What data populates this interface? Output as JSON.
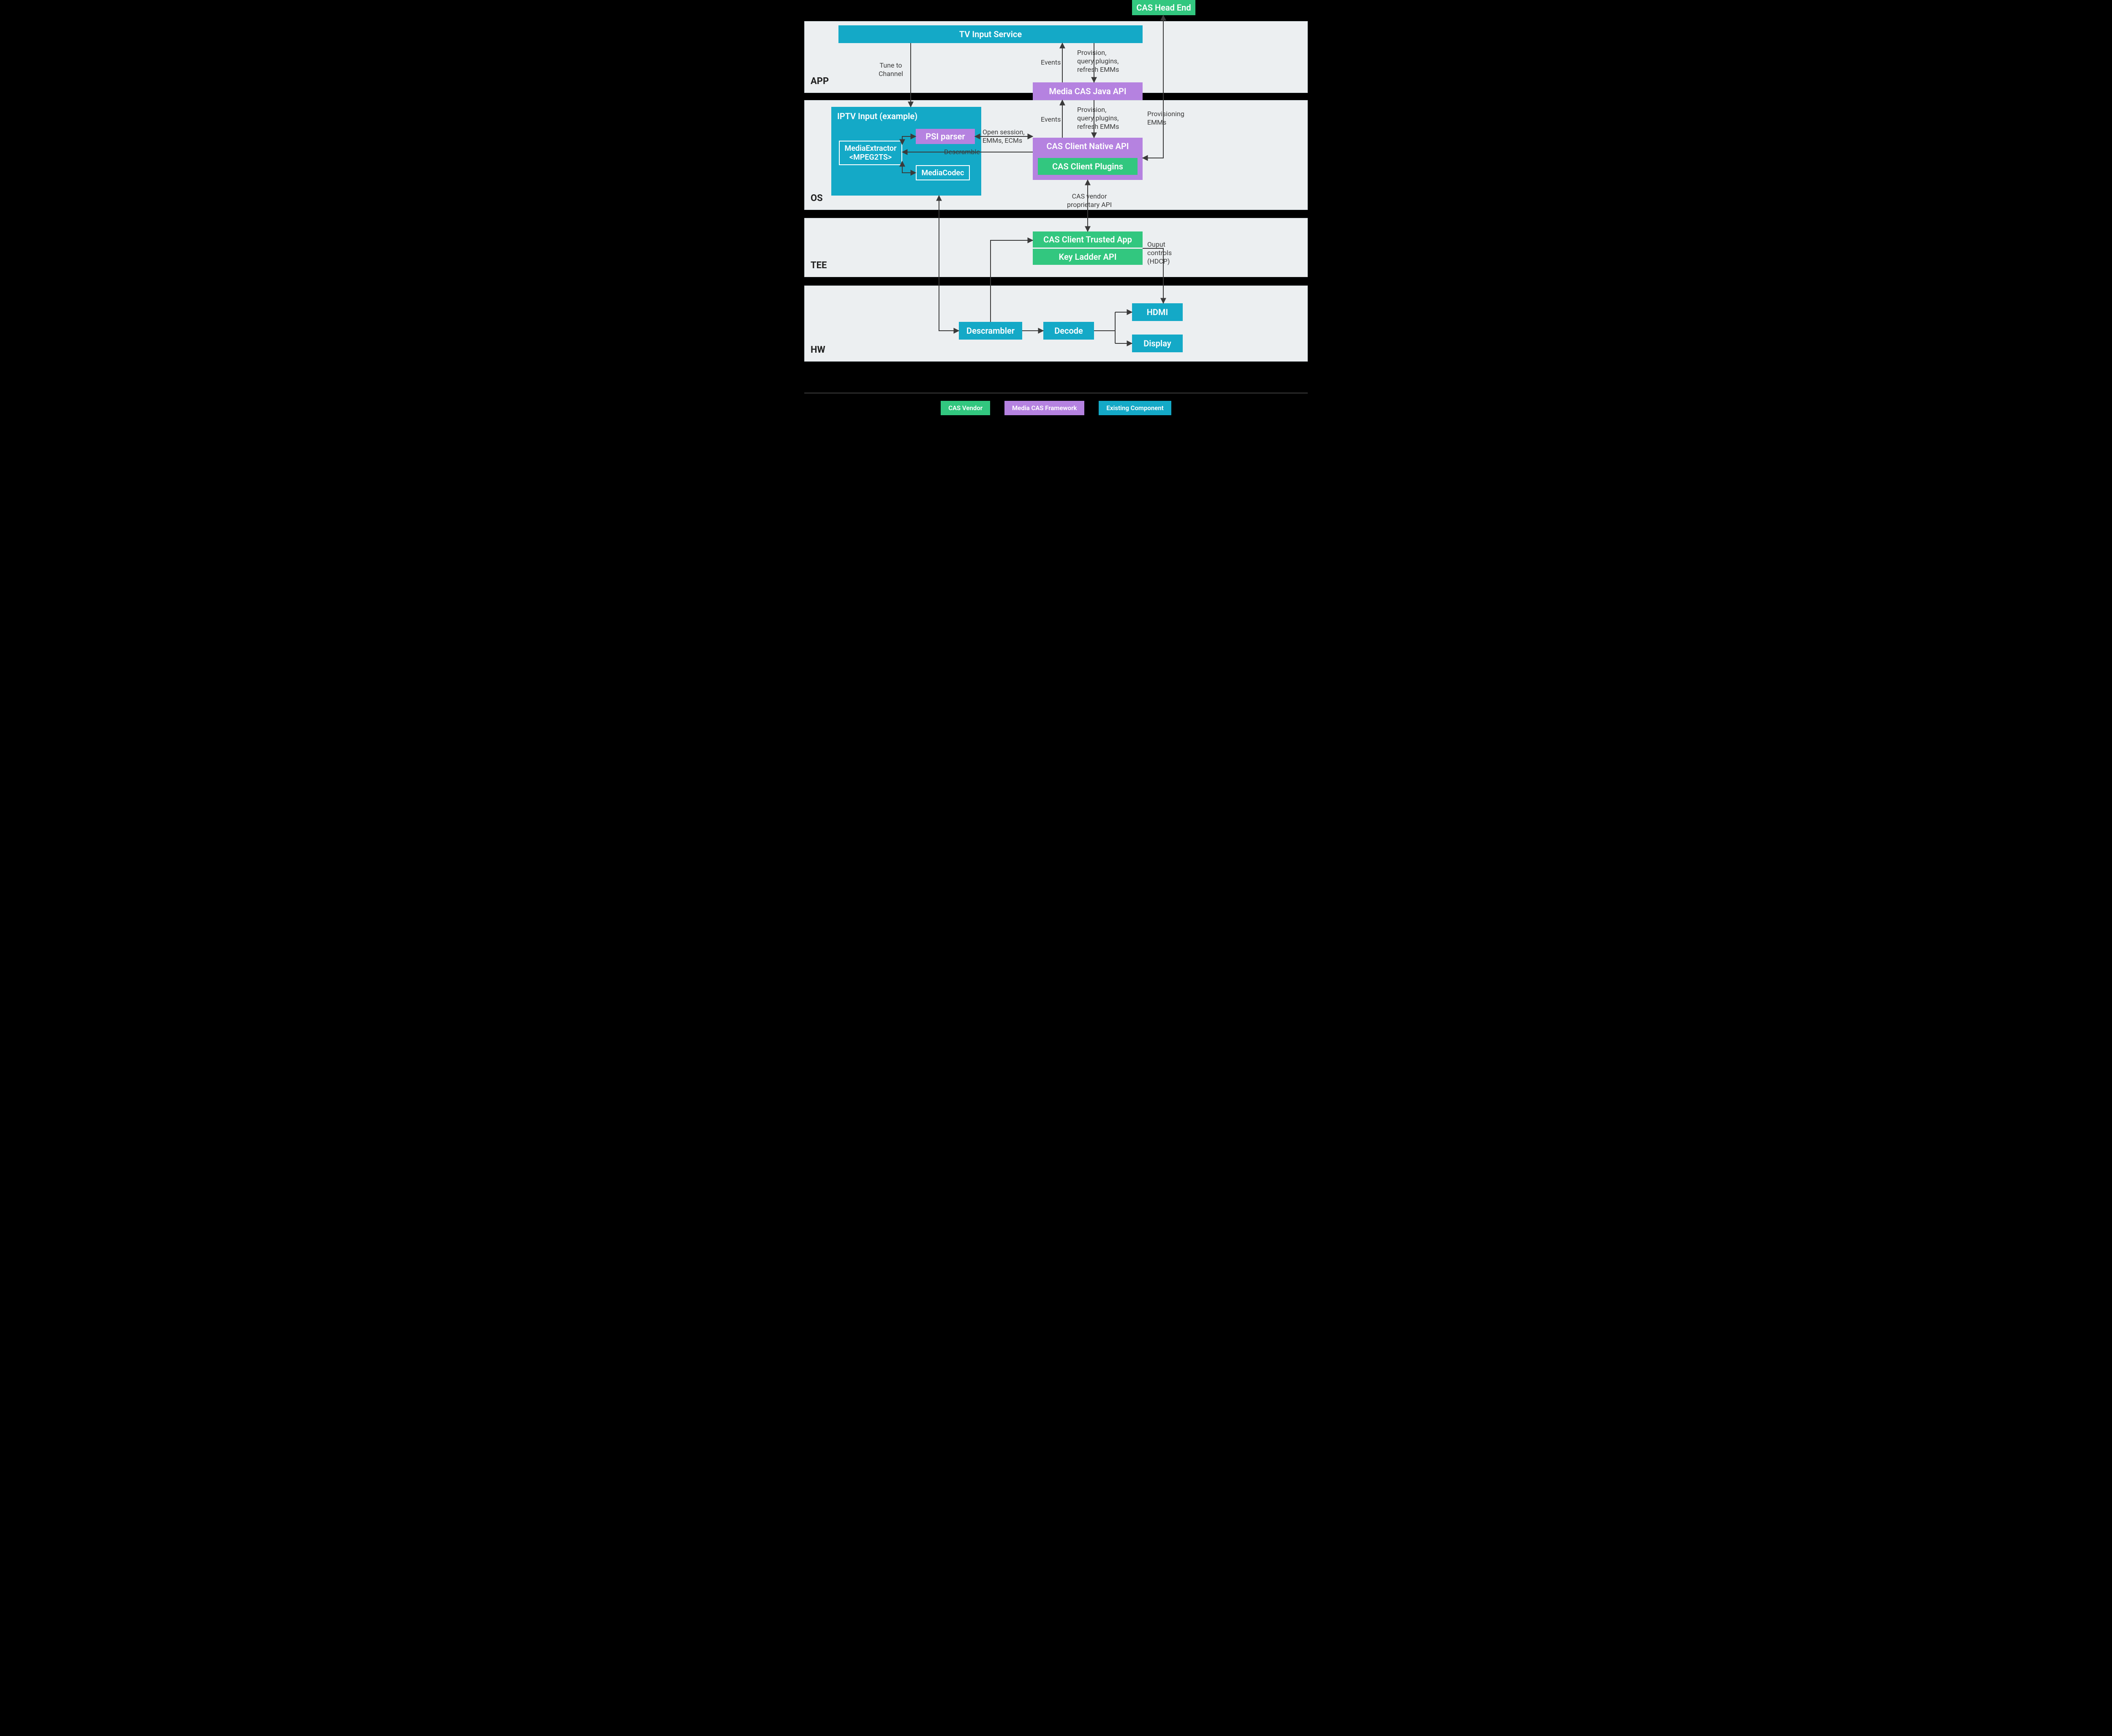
{
  "diagram": {
    "colors": {
      "teal": "#14a9c7",
      "green": "#32c77f",
      "purple": "#b582e0"
    },
    "layers": {
      "app": {
        "label": "APP"
      },
      "os": {
        "label": "OS"
      },
      "tee": {
        "label": "TEE"
      },
      "hw": {
        "label": "HW"
      }
    },
    "nodes": {
      "cas_head_end": "CAS Head End",
      "tv_input_service": "TV Input Service",
      "media_cas_java_api": "Media CAS Java API",
      "iptv_input": "IPTV Input (example)",
      "media_extractor": "MediaExtractor\n<MPEG2TS>",
      "psi_parser": "PSI parser",
      "media_codec": "MediaCodec",
      "cas_client_native_api": "CAS Client Native API",
      "cas_client_plugins": "CAS Client Plugins",
      "cas_client_trusted_app": "CAS Client Trusted App",
      "key_ladder_api": "Key Ladder API",
      "descrambler": "Descrambler",
      "decode": "Decode",
      "hdmi": "HDMI",
      "display": "Display"
    },
    "edge_labels": {
      "tune_to_channel": "Tune to\nChannel",
      "events_top": "Events",
      "provision_top": "Provision,\nquery plugins,\nrefresh EMMs",
      "events_mid": "Events",
      "provision_mid": "Provision,\nquery plugins,\nrefresh EMMs",
      "provisioning_emms": "Provisioning\nEMMs",
      "open_session": "Open session,\nEMMs, ECMs",
      "descramble": "Descramble",
      "cas_vendor_api": "CAS vendor\nproprietary API",
      "output_controls": "Ouput\ncontrols\n(HDCP)"
    },
    "legend": {
      "cas_vendor": "CAS Vendor",
      "media_cas_framework": "Media CAS Framework",
      "existing_component": "Existing Component"
    }
  }
}
